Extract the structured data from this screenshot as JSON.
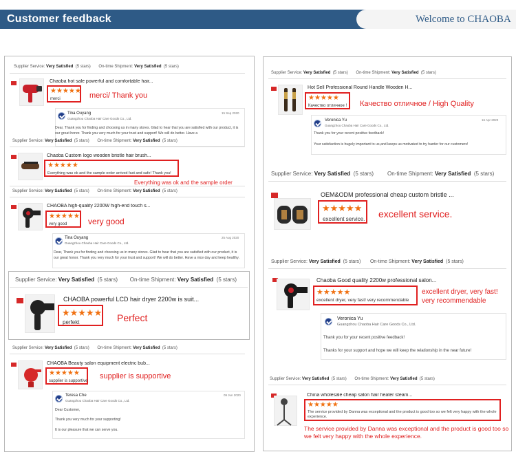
{
  "header": {
    "title": "Customer feedback",
    "welcome": "Welcome to CHAOBA"
  },
  "labels": {
    "supplier_service": "Supplier Service:",
    "on_time": "On-time Shipment:",
    "very_satisfied": "Very Satisfied",
    "five_stars": "(5 stars)",
    "stars": "★★★★★"
  },
  "left": {
    "r1": {
      "title": "Chaoba hot sale powerful and comfortable hair...",
      "comment": "merci",
      "annotation": "merci/ Thank you",
      "reply_name": "Tina Ouyang",
      "reply_company": "Guangzhou Chaoba Hair Care Goods Co., Ltd.",
      "reply_date": "15 Sep 2020",
      "reply_text": "Dear, Thank you for finding and choosing us in many stores. Glad to hear that you are satisfied with our product, it is our great honor. Thank you very much for your trust and support! We will do better. Have a"
    },
    "r2": {
      "title": "Chaoba Custom logo wooden bristle hair brush...",
      "comment": "Everything was ok and the sample order arrived fast and safe! Thank you!",
      "annotation": "Everything was ok and the sample order"
    },
    "r3": {
      "title": "CHAOBA high-quality 2200W high-end touch s...",
      "comment": "very good",
      "annotation": "very good",
      "reply_name": "Tina Ouyang",
      "reply_company": "Guangzhou Chaoba Hair Care Goods Co., Ltd.",
      "reply_date": "25 Aug 2020",
      "reply_text": "Dear, Thank you for finding and choosing us in many stores. Glad to hear that you are satisfied with our product, it is our great honor. Thank you very much for your trust and support! We will do better. Have a nice day and keep healthy."
    },
    "r4": {
      "title": "CHAOBA powerful LCD hair dryer 2200w is suit...",
      "comment": "perfekt",
      "annotation": "Perfect"
    },
    "r5": {
      "title": "CHAOBA Beauty salon equipment electric bub...",
      "comment": "supplier is supportive",
      "annotation": "supplier is supportive",
      "reply_name": "Teresa Che",
      "reply_company": "Guangzhou Chaoba Hair Care Goods Co., Ltd.",
      "reply_date": "09 Jun 2020",
      "reply_line1": "Dear Customer,",
      "reply_line2": "Thank you very much for your supporting!",
      "reply_line3": "It is our pleasure that we can serve you."
    }
  },
  "right": {
    "r1": {
      "title": "Hot Sell Professional Round Handle Wooden H...",
      "comment": "Качество отличное !",
      "annotation": "Качество отличное / High Quality",
      "reply_name": "Veronica Yu",
      "reply_company": "Guangzhou Chaoba Hair Care Goods Co., Ltd.",
      "reply_date": "16 Apr 2020",
      "reply_line1": "Thank you for your recent positive feedback!",
      "reply_line2": "Your satisfaction is hugely important to us,and keeps us motivated to try harder for our customers!"
    },
    "r2": {
      "title": "OEM&ODM professional cheap custom bristle ...",
      "comment": "excellent service.",
      "annotation": "excellent service."
    },
    "r3": {
      "title": "Chaoba Good quality 2200w professional salon...",
      "comment": "excellent dryer, very fast! very recommendable",
      "annotation_line1": "excellent dryer, very fast!",
      "annotation_line2": "very recommendable",
      "reply_name": "Veronica Yu",
      "reply_company": "Guangzhou Chaoba Hair Care Goods Co., Ltd.",
      "reply_line1": "Thank you for your recent positive feedback!",
      "reply_line2": "Thanks for your support and hope we will keep the relationship in the near future!"
    },
    "r4": {
      "title": "China wholesale cheap salon hair heater steam...",
      "comment": "The service provided by Danna was exceptional and the product is good too so we felt very happy with the whole experience.",
      "annotation_line1": "The service provided by Danna was exceptional and the product is good too so",
      "annotation_line2": "we felt very happy with the whole experience."
    }
  },
  "colors": {
    "header_bg": "#2e5a86",
    "accent_red": "#e02020",
    "star_orange": "#f07010"
  }
}
